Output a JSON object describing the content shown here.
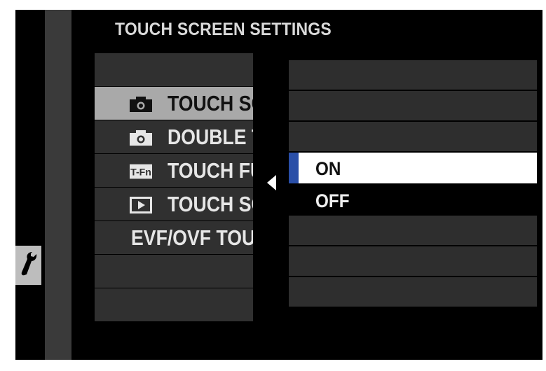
{
  "title": "TOUCH SCREEN SETTINGS",
  "sidebar": {
    "icon": "wrench-icon"
  },
  "menu": {
    "items": [
      {
        "label": "",
        "icon": ""
      },
      {
        "label": "TOUCH SCREEN SETTING",
        "icon": "camera-icon",
        "selected": true
      },
      {
        "label": "DOUBLE TAP SETTING",
        "icon": "camera-icon"
      },
      {
        "label": "TOUCH FUNCTION",
        "icon": "tfn-icon",
        "icon_text": "T-Fn"
      },
      {
        "label": "TOUCH SCREEN SETTING",
        "icon": "playback-icon"
      },
      {
        "label": "EVF/OVF TOUCH SCREEN AREA SETTINGS",
        "icon": ""
      },
      {
        "label": "",
        "icon": ""
      },
      {
        "label": "",
        "icon": ""
      }
    ]
  },
  "options": {
    "items": [
      {
        "label": ""
      },
      {
        "label": ""
      },
      {
        "label": ""
      },
      {
        "label": "ON",
        "active": true
      },
      {
        "label": "OFF"
      },
      {
        "label": ""
      },
      {
        "label": ""
      },
      {
        "label": ""
      }
    ]
  },
  "colors": {
    "accent": "#2a4fa8",
    "selected_row": "#a9a9a9",
    "row_bg": "#303030"
  }
}
